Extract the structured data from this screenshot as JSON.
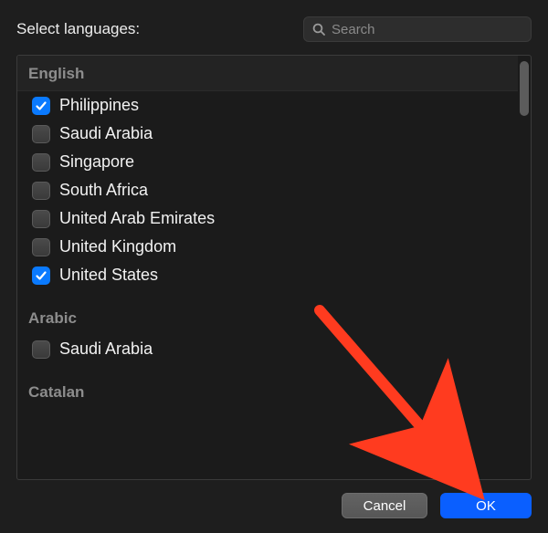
{
  "title": "Select languages:",
  "search": {
    "placeholder": "Search",
    "value": ""
  },
  "groups": [
    {
      "name": "English",
      "sticky": true,
      "items": [
        {
          "label": "Philippines",
          "checked": true
        },
        {
          "label": "Saudi Arabia",
          "checked": false
        },
        {
          "label": "Singapore",
          "checked": false
        },
        {
          "label": "South Africa",
          "checked": false
        },
        {
          "label": "United Arab Emirates",
          "checked": false
        },
        {
          "label": "United Kingdom",
          "checked": false
        },
        {
          "label": "United States",
          "checked": true
        }
      ]
    },
    {
      "name": "Arabic",
      "sticky": false,
      "items": [
        {
          "label": "Saudi Arabia",
          "checked": false
        }
      ]
    },
    {
      "name": "Catalan",
      "sticky": false,
      "items": []
    }
  ],
  "buttons": {
    "cancel": "Cancel",
    "ok": "OK"
  },
  "colors": {
    "accent": "#0a7aff",
    "primaryButton": "#0a5fff"
  },
  "icons": {
    "search": "search-icon",
    "check": "check-icon"
  },
  "annotation": {
    "arrow_target": "ok-button",
    "arrow_color": "#ff3b1f"
  }
}
